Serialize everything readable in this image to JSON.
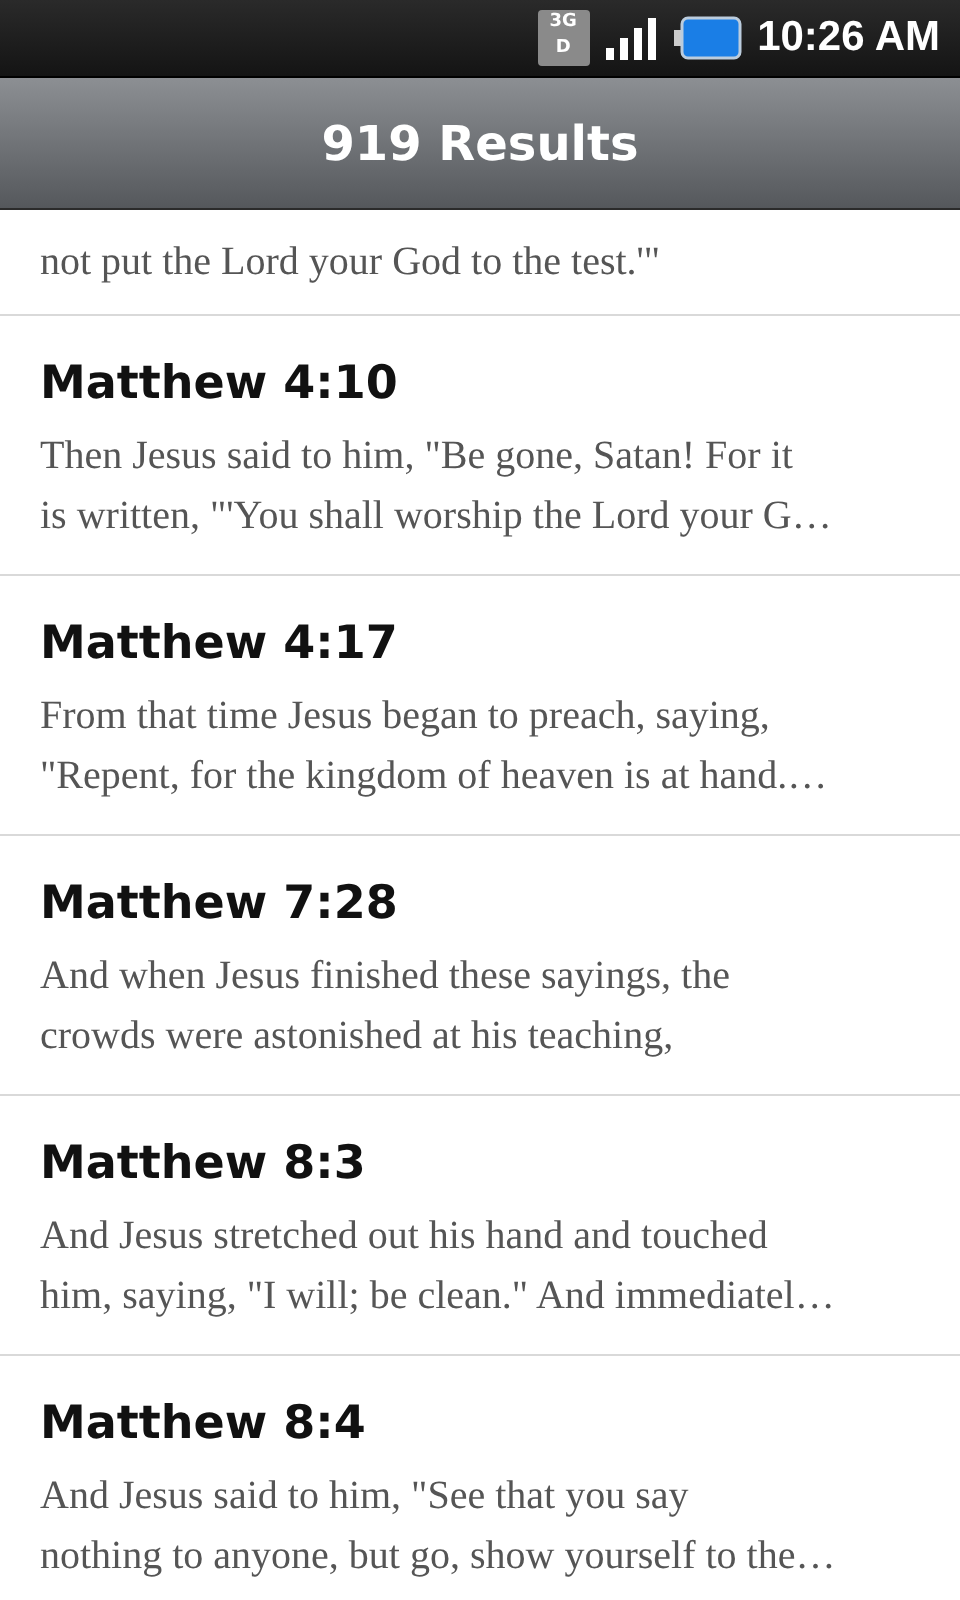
{
  "status_bar": {
    "network": "3G",
    "network_sub": "D",
    "time": "10:26 AM"
  },
  "title": "919 Results",
  "partial_result": {
    "lines": [
      "not put the Lord your God to the test.'\""
    ]
  },
  "results": [
    {
      "reference": "Matthew 4:10",
      "lines": [
        "Then Jesus said to him, \"Be gone, Satan! For it",
        "is written, \"'You shall worship the Lord your G…"
      ]
    },
    {
      "reference": "Matthew 4:17",
      "lines": [
        "From that time Jesus began to preach, saying,",
        "\"Repent, for the kingdom of heaven is at hand.…"
      ]
    },
    {
      "reference": "Matthew 7:28",
      "lines": [
        "And when Jesus finished these sayings, the",
        "crowds were astonished at his teaching,"
      ]
    },
    {
      "reference": "Matthew 8:3",
      "lines": [
        "And Jesus stretched out his hand and touched",
        "him, saying, \"I will; be clean.\" And immediatel…"
      ]
    },
    {
      "reference": "Matthew 8:4",
      "lines": [
        "And Jesus said to him, \"See that you say",
        "nothing to anyone, but go, show yourself to the…"
      ]
    }
  ]
}
